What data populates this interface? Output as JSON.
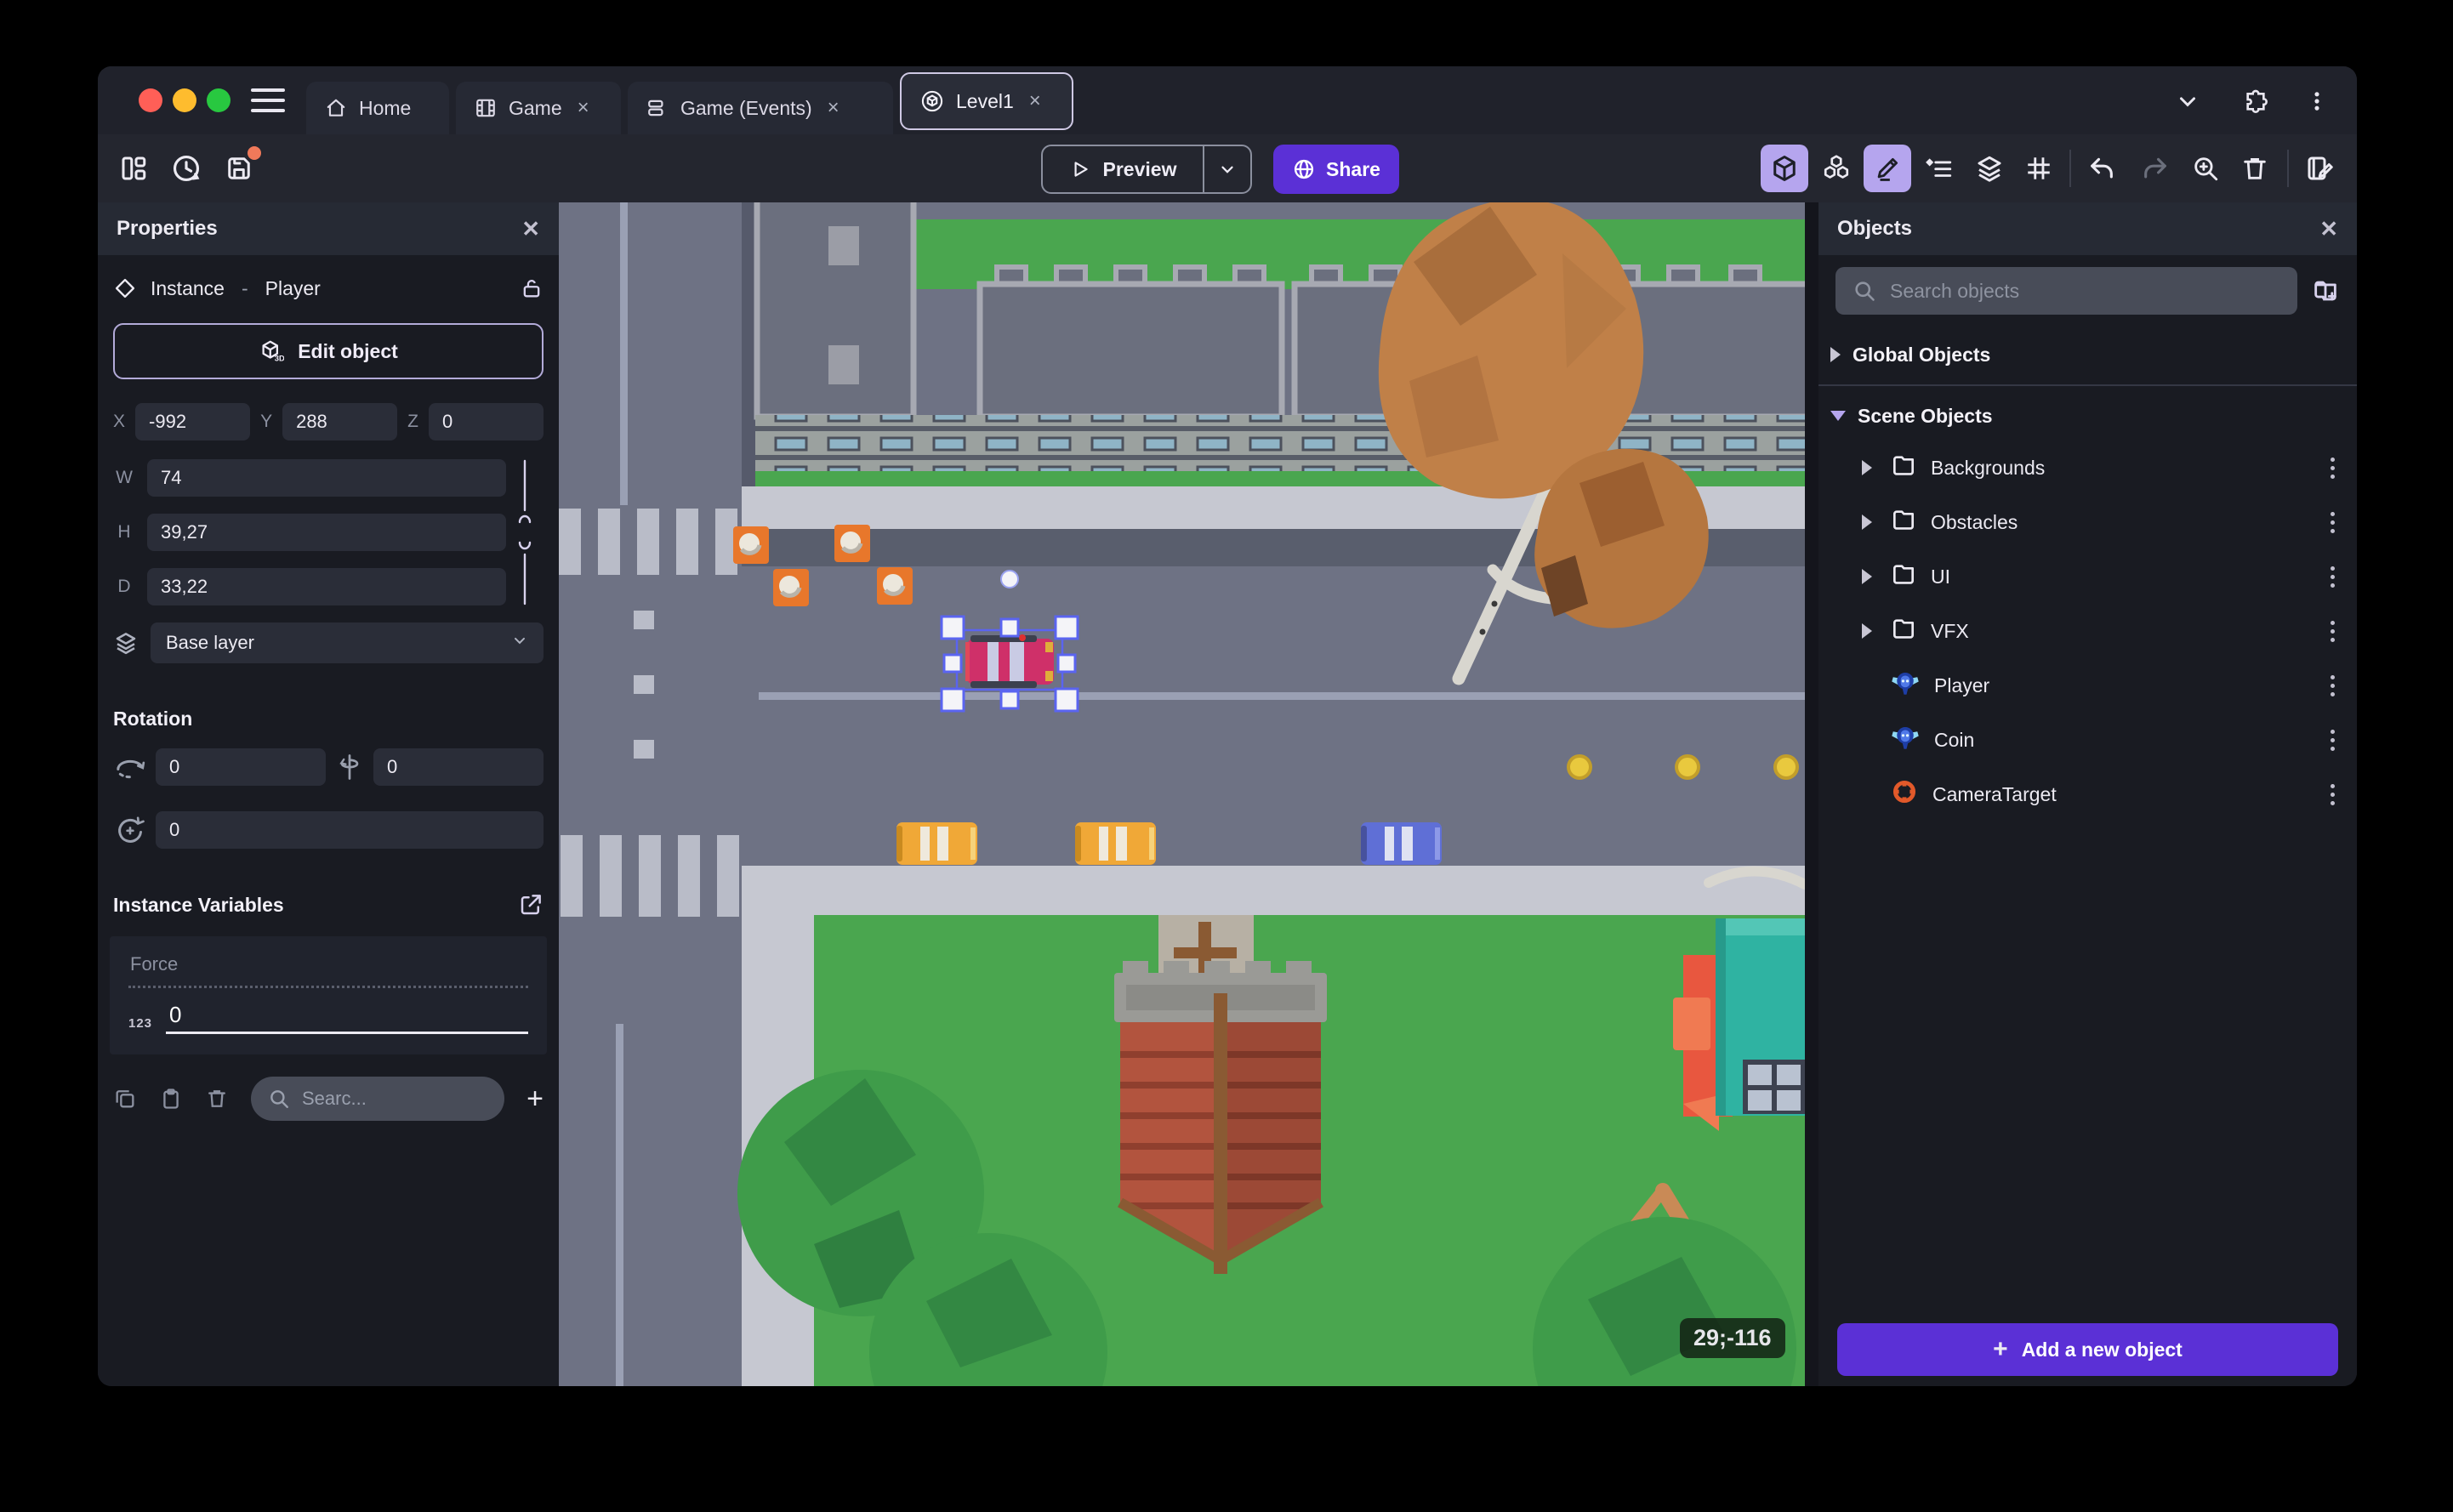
{
  "colors": {
    "accent": "#5b30d6",
    "accent-light": "#b5a5ee",
    "badge": "#f0795a",
    "traffic-red": "#ff5f57",
    "traffic-yellow": "#febc2e",
    "traffic-green": "#28c840",
    "panel-bg": "#191b22",
    "field-bg": "#2a2d38",
    "selection": "#5a64f0"
  },
  "titlebar": {
    "tabs": [
      {
        "label": "Home",
        "icon": "home",
        "closable": false,
        "active": false
      },
      {
        "label": "Game",
        "icon": "film",
        "closable": true,
        "active": false
      },
      {
        "label": "Game (Events)",
        "icon": "events",
        "closable": true,
        "active": false
      },
      {
        "label": "Level1",
        "icon": "scene",
        "closable": true,
        "active": true
      }
    ],
    "close_glyph": "×"
  },
  "toolbar": {
    "preview_label": "Preview",
    "share_label": "Share"
  },
  "properties": {
    "title": "Properties",
    "instance_type": "Instance",
    "separator": "-",
    "instance_name": "Player",
    "edit_object_label": "Edit object",
    "coords": {
      "x_label": "X",
      "x": "-992",
      "y_label": "Y",
      "y": "288",
      "z_label": "Z",
      "z": "0"
    },
    "size": {
      "w_label": "W",
      "w": "74",
      "h_label": "H",
      "h": "39,27",
      "d_label": "D",
      "d": "33,22"
    },
    "layer": "Base layer",
    "rotation": {
      "title": "Rotation",
      "x": "0",
      "y": "0",
      "z": "0"
    },
    "variables": {
      "title": "Instance Variables",
      "items": [
        {
          "name": "Force",
          "type": "123",
          "value": "0"
        }
      ],
      "search_placeholder": "Searc..."
    }
  },
  "scene_view": {
    "coordinates": "29;-116"
  },
  "objects_panel": {
    "title": "Objects",
    "search_placeholder": "Search objects",
    "groups": {
      "global": "Global Objects",
      "scene": "Scene Objects"
    },
    "tree": [
      {
        "label": "Backgrounds",
        "type": "folder"
      },
      {
        "label": "Obstacles",
        "type": "folder"
      },
      {
        "label": "UI",
        "type": "folder"
      },
      {
        "label": "VFX",
        "type": "folder"
      },
      {
        "label": "Player",
        "type": "object3d"
      },
      {
        "label": "Coin",
        "type": "object3d"
      },
      {
        "label": "CameraTarget",
        "type": "camera"
      }
    ],
    "add_button_label": "Add a new object"
  }
}
